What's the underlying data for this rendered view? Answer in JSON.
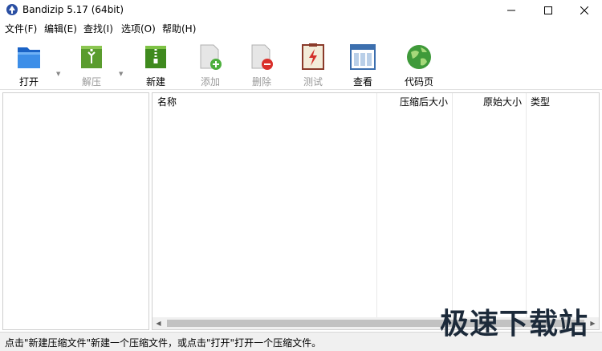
{
  "window": {
    "title": "Bandizip 5.17 (64bit)"
  },
  "menu": [
    {
      "label": "文件(F)"
    },
    {
      "label": "编辑(E)"
    },
    {
      "label": "查找(I)"
    },
    {
      "label": "选项(O)"
    },
    {
      "label": "帮助(H)"
    }
  ],
  "toolbar": [
    {
      "label": "打开",
      "icon": "folder-open-icon",
      "enabled": true
    },
    {
      "label": "解压",
      "icon": "extract-archive-icon",
      "enabled": false
    },
    {
      "label": "新建",
      "icon": "new-archive-icon",
      "enabled": true
    },
    {
      "label": "添加",
      "icon": "add-file-icon",
      "enabled": false
    },
    {
      "label": "删除",
      "icon": "delete-file-icon",
      "enabled": false
    },
    {
      "label": "测试",
      "icon": "test-archive-icon",
      "enabled": false
    },
    {
      "label": "查看",
      "icon": "view-icon",
      "enabled": true
    },
    {
      "label": "代码页",
      "icon": "globe-icon",
      "enabled": true
    }
  ],
  "file_list": {
    "columns": [
      "名称",
      "压缩后大小",
      "原始大小",
      "类型"
    ]
  },
  "status": {
    "text": "点击\"新建压缩文件\"新建一个压缩文件，或点击\"打开\"打开一个压缩文件。"
  },
  "watermark": {
    "text": "极速下载站"
  }
}
